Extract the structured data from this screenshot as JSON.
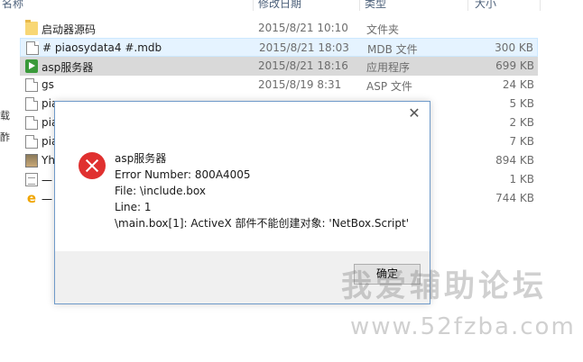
{
  "header": {
    "name": "名称",
    "date": "修改日期",
    "type": "类型",
    "size": "大小"
  },
  "left_strip": [
    "载",
    "酢"
  ],
  "rows": [
    {
      "name": "启动器源码",
      "date": "2015/8/21 10:10",
      "type": "文件夹",
      "size": "",
      "icon": "folder-icon"
    },
    {
      "name": "# piaosydata4  #.mdb",
      "date": "2015/8/21 18:03",
      "type": "MDB 文件",
      "size": "300 KB",
      "icon": "document-icon"
    },
    {
      "name": "asp服务器",
      "date": "2015/8/21 18:16",
      "type": "应用程序",
      "size": "699 KB",
      "icon": "application-icon"
    },
    {
      "name": "gs",
      "date": "2015/8/19 8:31",
      "type": "ASP 文件",
      "size": "24 KB",
      "icon": "document-icon"
    },
    {
      "name": "pia",
      "date": "",
      "type": "",
      "size": "5 KB",
      "icon": "document-icon"
    },
    {
      "name": "pia",
      "date": "",
      "type": "",
      "size": "2 KB",
      "icon": "document-icon"
    },
    {
      "name": "pia",
      "date": "",
      "type": "",
      "size": "7 KB",
      "icon": "document-icon"
    },
    {
      "name": "Yh",
      "date": "",
      "type": "",
      "size": "894 KB",
      "icon": "image-icon"
    },
    {
      "name": "一",
      "date": "",
      "type": "",
      "size": "1 KB",
      "icon": "text-file-icon"
    },
    {
      "name": "一",
      "date": "",
      "type": "",
      "size": "744 KB",
      "icon": "ie-shortcut-icon"
    }
  ],
  "dialog": {
    "close_glyph": "✕",
    "lines": [
      "asp服务器",
      "Error Number: 800A4005",
      "File: \\include.box",
      "Line: 1",
      "\\main.box[1]: ActiveX 部件不能创建对象: 'NetBox.Script'"
    ],
    "ok_label": "确定"
  },
  "watermark": {
    "text": "我爱辅助论坛",
    "url": "www.52fzba.com"
  },
  "colors": {
    "selection_light": "#e5f3ff",
    "selection_gray": "#d9d9d9",
    "error_red": "#e0302f"
  }
}
